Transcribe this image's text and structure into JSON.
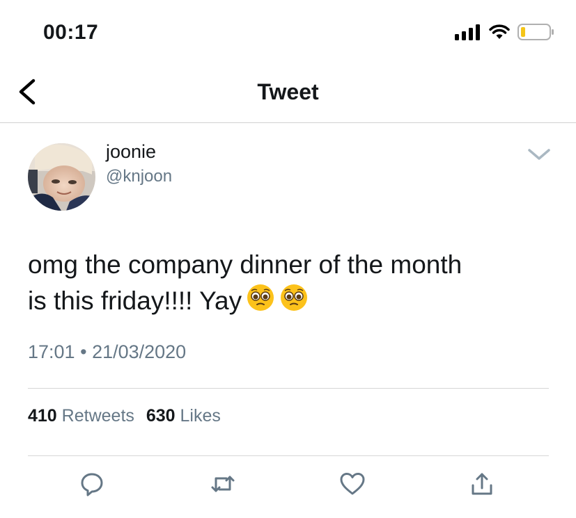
{
  "status_bar": {
    "time": "00:17",
    "icons": [
      "cellular-signal-icon",
      "wifi-icon",
      "battery-low-icon"
    ],
    "battery_color": "#f5c518"
  },
  "header": {
    "title": "Tweet",
    "back_icon": "chevron-left-icon"
  },
  "tweet": {
    "author": {
      "display_name": "joonie",
      "handle": "@knjoon"
    },
    "text_line1": "omg the company dinner of the month",
    "text_line2": "is this friday!!!! Yay",
    "emojis": [
      "pleading-face-emoji",
      "pleading-face-emoji"
    ],
    "time": "17:01",
    "separator": "•",
    "date": "21/03/2020",
    "stats": {
      "retweets_count": "410",
      "retweets_label": "Retweets",
      "likes_count": "630",
      "likes_label": "Likes"
    },
    "actions": [
      "reply-icon",
      "retweet-icon",
      "like-icon",
      "share-icon"
    ]
  },
  "colors": {
    "text_primary": "#14171a",
    "text_secondary": "#657786",
    "action_icon": "#657786",
    "divider": "#d6d6d6"
  }
}
